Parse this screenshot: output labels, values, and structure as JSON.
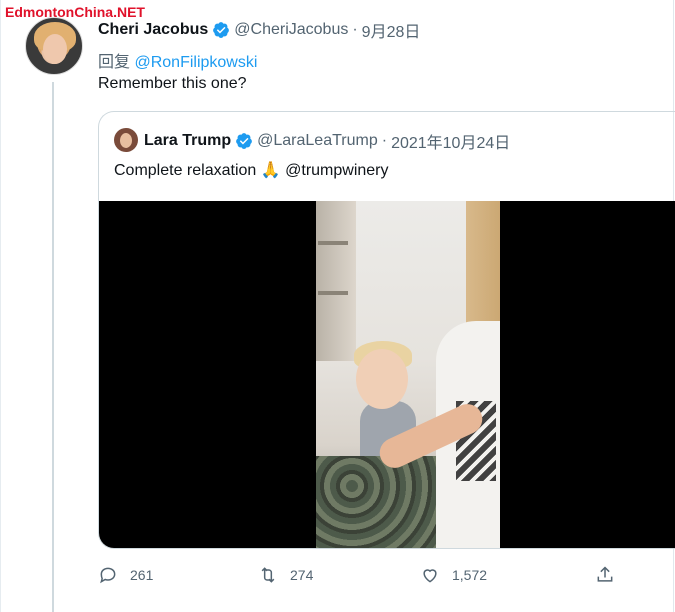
{
  "watermark": "EdmontonChina.NET",
  "tweet": {
    "author_name": "Cheri Jacobus",
    "author_handle": "@CheriJacobus",
    "separator": "·",
    "date": "9月28日",
    "reply_prefix": "回复",
    "reply_to": "@RonFilipkowski",
    "text": "Remember this one?"
  },
  "quote": {
    "author_name": "Lara Trump",
    "author_handle": "@LaraLeaTrump",
    "separator": "·",
    "date": "2021年10月24日",
    "text": "Complete relaxation",
    "emoji": "🙏",
    "mention": "@trumpwinery"
  },
  "actions": {
    "replies": "261",
    "retweets": "274",
    "likes": "1,572"
  },
  "colors": {
    "accent": "#1d9bf0",
    "muted": "#536471",
    "verified": "#1d9bf0",
    "watermark": "#e0122b"
  },
  "icons": {
    "verified": "verified-badge-icon",
    "reply": "reply-icon",
    "retweet": "retweet-icon",
    "like": "heart-icon",
    "share": "share-icon"
  }
}
